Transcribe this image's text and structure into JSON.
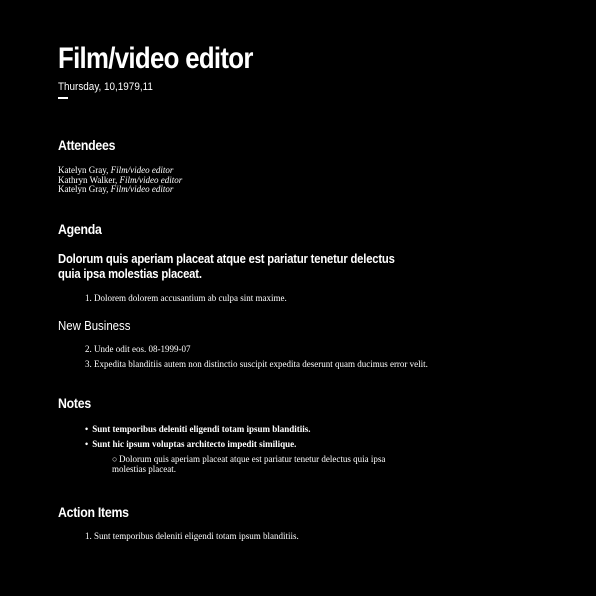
{
  "header": {
    "title": "Film/video editor",
    "date": "Thursday, 10,1979,11"
  },
  "attendees": {
    "heading": "Attendees",
    "people": [
      {
        "name": "Katelyn Gray, ",
        "role": "Film/video editor"
      },
      {
        "name": "Kathryn Walker, ",
        "role": "Film/video editor"
      },
      {
        "name": "Katelyn Gray, ",
        "role": "Film/video editor"
      }
    ]
  },
  "agenda": {
    "heading": "Agenda",
    "topic": "Dolorum quis aperiam placeat atque est pariatur tenetur delectus quia ipsa molestias placeat.",
    "items": [
      "1. Dolorem dolorem accusantium ab culpa sint maxime."
    ]
  },
  "new_business": {
    "heading": "New Business",
    "items": [
      "2. Unde odit eos. 08-1999-07",
      "3. Expedita blanditiis autem non distinctio suscipit expedita deserunt quam ducimus error velit."
    ]
  },
  "notes": {
    "heading": "Notes",
    "bullets": [
      "Sunt temporibus deleniti eligendi totam ipsum blanditiis.",
      "Sunt hic ipsum voluptas architecto impedit similique."
    ],
    "sub_bullet": "Dolorum quis aperiam placeat atque est pariatur tenetur delectus quia ipsa molestias placeat."
  },
  "action_items": {
    "heading": "Action Items",
    "items": [
      "1. Sunt temporibus deleniti eligendi totam ipsum blanditiis."
    ]
  }
}
